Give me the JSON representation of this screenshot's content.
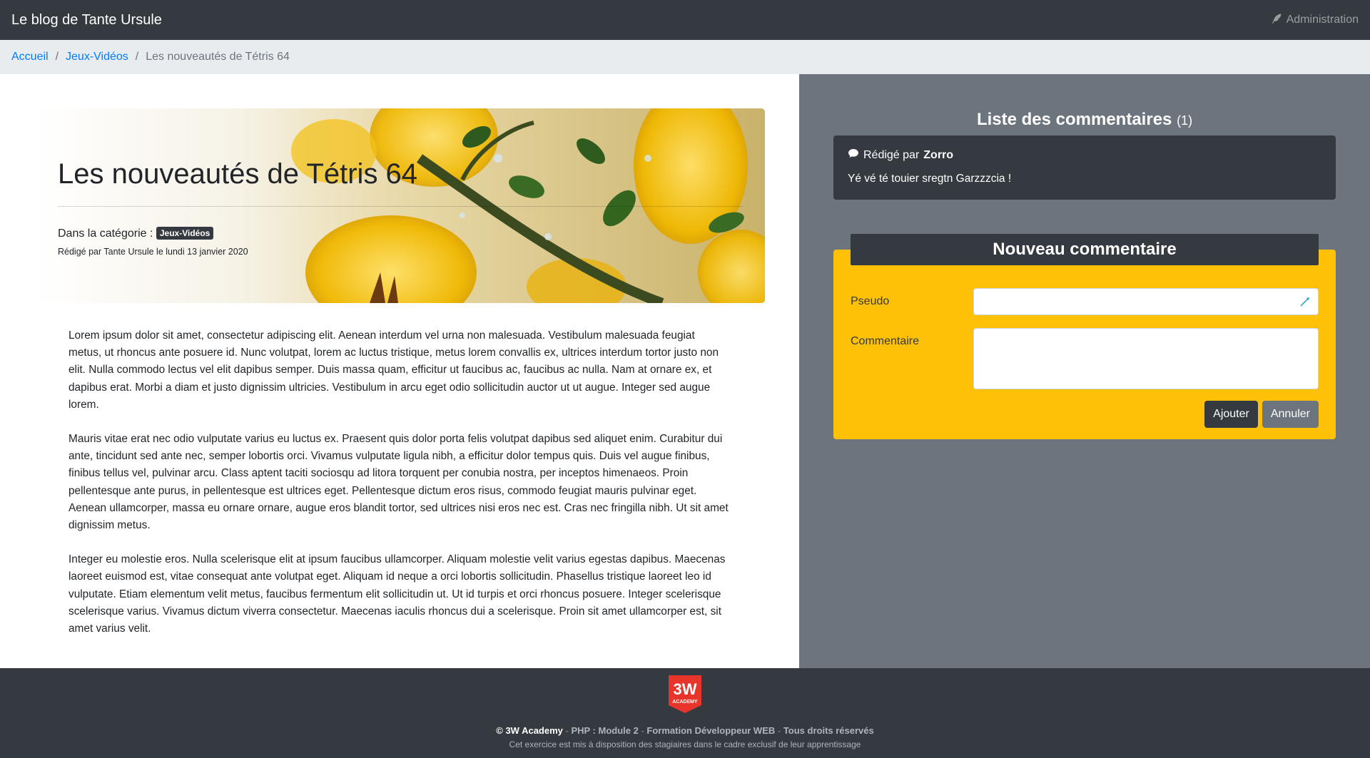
{
  "navbar": {
    "brand": "Le blog de Tante Ursule",
    "admin_label": "Administration"
  },
  "breadcrumb": {
    "home": "Accueil",
    "category": "Jeux-Vidéos",
    "current": "Les nouveautés de Tétris 64"
  },
  "article": {
    "title": "Les nouveautés de Tétris 64",
    "category_label": "Dans la catégorie :",
    "category_badge": "Jeux-Vidéos",
    "meta": "Rédigé par Tante Ursule le lundi 13 janvier 2020",
    "paragraphs": [
      "Lorem ipsum dolor sit amet, consectetur adipiscing elit. Aenean interdum vel urna non malesuada. Vestibulum malesuada feugiat metus, ut rhoncus ante posuere id. Nunc volutpat, lorem ac luctus tristique, metus lorem convallis ex, ultrices interdum tortor justo non elit. Nulla commodo lectus vel elit dapibus semper. Duis massa quam, efficitur ut faucibus ac, faucibus ac nulla. Nam at ornare ex, et dapibus erat. Morbi a diam et justo dignissim ultricies. Vestibulum in arcu eget odio sollicitudin auctor ut ut augue. Integer sed augue lorem.",
      "Mauris vitae erat nec odio vulputate varius eu luctus ex. Praesent quis dolor porta felis volutpat dapibus sed aliquet enim. Curabitur dui ante, tincidunt sed ante nec, semper lobortis orci. Vivamus vulputate ligula nibh, a efficitur dolor tempus quis. Duis vel augue finibus, finibus tellus vel, pulvinar arcu. Class aptent taciti sociosqu ad litora torquent per conubia nostra, per inceptos himenaeos. Proin pellentesque ante purus, in pellentesque est ultrices eget. Pellentesque dictum eros risus, commodo feugiat mauris pulvinar eget. Aenean ullamcorper, massa eu ornare ornare, augue eros blandit tortor, sed ultrices nisi eros nec est. Cras nec fringilla nibh. Ut sit amet dignissim metus.",
      "Integer eu molestie eros. Nulla scelerisque elit at ipsum faucibus ullamcorper. Aliquam molestie velit varius egestas dapibus. Maecenas laoreet euismod est, vitae consequat ante volutpat eget. Aliquam id neque a orci lobortis sollicitudin. Phasellus tristique laoreet leo id vulputate. Etiam elementum velit metus, faucibus fermentum elit sollicitudin ut. Ut id turpis et orci rhoncus posuere. Integer scelerisque scelerisque varius. Vivamus dictum viverra consectetur. Maecenas iaculis rhoncus dui a scelerisque. Proin sit amet ullamcorper est, sit amet varius velit."
    ]
  },
  "comments": {
    "title": "Liste des commentaires",
    "count": "(1)",
    "items": [
      {
        "prefix": "Rédigé par",
        "author": "Zorro",
        "text": "Yé vé té touier sregtn Garzzzcia !"
      }
    ]
  },
  "new_comment": {
    "title": "Nouveau commentaire",
    "pseudo_label": "Pseudo",
    "comment_label": "Commentaire",
    "submit_label": "Ajouter",
    "cancel_label": "Annuler"
  },
  "footer": {
    "logo_text_top": "3W",
    "logo_text_bottom": "ACADEMY",
    "copyright": "© 3W Academy",
    "sep1": " - ",
    "course": "PHP : Module 2",
    "sep2": " - ",
    "program": "Formation Développeur WEB",
    "sep3": " - ",
    "rights": "Tous droits réservés",
    "notice": "Cet exercice est mis à disposition des stagiaires dans le cadre exclusif de leur apprentissage"
  },
  "colors": {
    "dark": "#343a40",
    "secondary": "#6c757d",
    "warning": "#ffc107",
    "link": "#007bff",
    "breadcrumb_bg": "#e9ecef"
  }
}
